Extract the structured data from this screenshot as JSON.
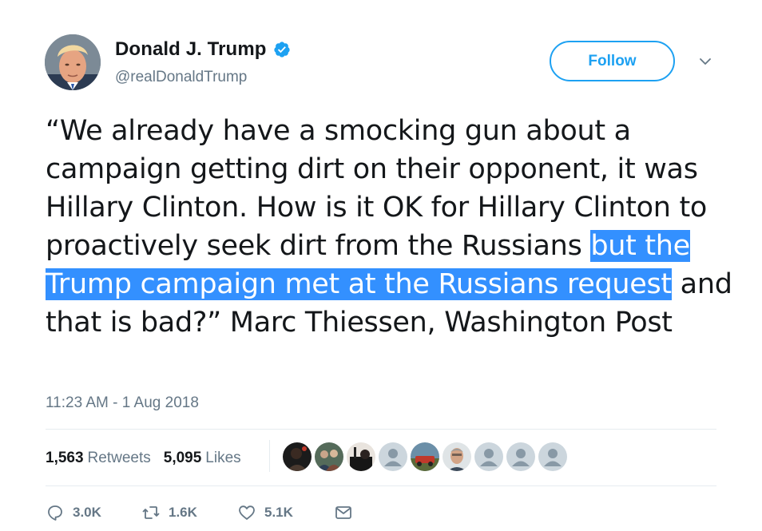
{
  "author": {
    "display_name": "Donald J. Trump",
    "handle": "@realDonaldTrump",
    "verified": true
  },
  "follow_button": {
    "label": "Follow"
  },
  "tweet": {
    "text_before": "“We already have a smocking gun about a campaign getting dirt on their opponent, it was Hillary Clinton. How is it OK for Hillary Clinton to proactively seek dirt from the Russians ",
    "text_highlighted": "but the Trump campaign met at the Russians request",
    "text_after": " and that is bad?” Marc Thiessen, Washington Post",
    "timestamp": "11:23 AM - 1 Aug 2018"
  },
  "stats": {
    "retweets_count": "1,563",
    "retweets_label": "Retweets",
    "likes_count": "5,095",
    "likes_label": "Likes"
  },
  "likers": [
    {
      "icon": "user-avatar-dark"
    },
    {
      "icon": "user-avatar-group"
    },
    {
      "icon": "user-avatar-dark-2"
    },
    {
      "icon": "default-avatar"
    },
    {
      "icon": "user-avatar-outdoor"
    },
    {
      "icon": "user-avatar-portrait"
    },
    {
      "icon": "default-avatar"
    },
    {
      "icon": "default-avatar"
    },
    {
      "icon": "default-avatar"
    }
  ],
  "actions": {
    "reply_count": "3.0K",
    "retweet_count": "1.6K",
    "like_count": "5.1K"
  },
  "colors": {
    "accent": "#1da1f2",
    "highlight": "#3390ff",
    "text": "#14171a",
    "secondary_text": "#657786"
  }
}
